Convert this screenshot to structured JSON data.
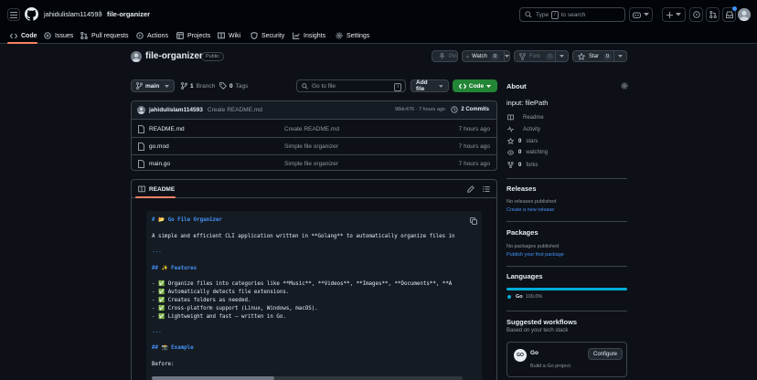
{
  "header": {
    "owner": "jahidulislam114593",
    "separator": "/",
    "repo": "file-organizer",
    "search_prefix": "Type",
    "search_key": "/",
    "search_suffix": "to search"
  },
  "tabs": [
    {
      "label": "Code",
      "icon": "code-icon"
    },
    {
      "label": "Issues",
      "icon": "issue-icon"
    },
    {
      "label": "Pull requests",
      "icon": "pull-request-icon"
    },
    {
      "label": "Actions",
      "icon": "play-icon"
    },
    {
      "label": "Projects",
      "icon": "table-icon"
    },
    {
      "label": "Wiki",
      "icon": "book-icon"
    },
    {
      "label": "Security",
      "icon": "shield-icon"
    },
    {
      "label": "Insights",
      "icon": "graph-icon"
    },
    {
      "label": "Settings",
      "icon": "gear-icon"
    }
  ],
  "repo_header": {
    "title": "file-organizer",
    "visibility": "Public",
    "pin": "Pin",
    "watch": "Watch",
    "watch_count": "0",
    "fork": "Fork",
    "fork_count": "0",
    "star": "Star",
    "star_count": "0"
  },
  "file_nav": {
    "branch": "main",
    "branch_count": "1",
    "branch_label": "Branch",
    "tag_count": "0",
    "tag_label": "Tags",
    "go_to_file": "Go to file",
    "go_to_file_key": "t",
    "add_file": "Add file",
    "code": "Code"
  },
  "latest_commit": {
    "author": "jahidulislam114593",
    "message": "Create README.md",
    "meta": "98dc476 · 7 hours ago",
    "commits": "2 Commits"
  },
  "files": [
    {
      "name": "README.md",
      "message": "Create README.md",
      "time": "7 hours ago"
    },
    {
      "name": "go.mod",
      "message": "Simple file organizer",
      "time": "7 hours ago"
    },
    {
      "name": "main.go",
      "message": "Simple file organizer",
      "time": "7 hours ago"
    }
  ],
  "readme": {
    "tab": "README",
    "lines": [
      {
        "text": "# 📂 Go File Organizer",
        "kind": "h"
      },
      {
        "text": "A simple and efficient CLI application written in **Golang** to automatically organize files in",
        "kind": "p"
      },
      {
        "text": "---",
        "kind": "hr"
      },
      {
        "text": "## ✨ Features",
        "kind": "h"
      },
      {
        "text": "- ✅ Organize files into categories like **Music**, **Videos**, **Images**, **Documents**, **A",
        "kind": "p"
      },
      {
        "text": "- ✅ Automatically detects file extensions.",
        "kind": "p"
      },
      {
        "text": "- ✅ Creates folders as needed.",
        "kind": "p"
      },
      {
        "text": "- ✅ Cross-platform support (Linux, Windows, macOS).",
        "kind": "p"
      },
      {
        "text": "- ✅ Lightweight and fast — written in Go.",
        "kind": "p"
      },
      {
        "text": "---",
        "kind": "hr"
      },
      {
        "text": "## 📸 Example",
        "kind": "h"
      },
      {
        "text": "Before:",
        "kind": "p"
      }
    ]
  },
  "about": {
    "title": "About",
    "description": "input: filePath",
    "items": [
      {
        "icon": "book-icon",
        "bold": "",
        "label": "Readme"
      },
      {
        "icon": "pulse-icon",
        "bold": "",
        "label": "Activity"
      },
      {
        "icon": "star-icon",
        "bold": "0",
        "label": "stars"
      },
      {
        "icon": "eye-icon",
        "bold": "0",
        "label": "watching"
      },
      {
        "icon": "fork-icon",
        "bold": "0",
        "label": "forks"
      }
    ]
  },
  "releases": {
    "title": "Releases",
    "text": "No releases published",
    "link": "Create a new release"
  },
  "packages": {
    "title": "Packages",
    "text": "No packages published",
    "link": "Publish your first package"
  },
  "languages": {
    "title": "Languages",
    "name": "Go",
    "percent": "100.0%",
    "value": 100,
    "color": "#00add8"
  },
  "workflows": {
    "title": "Suggested workflows",
    "subtitle": "Based on your tech stack",
    "card_name": "Go",
    "card_desc": "Build a Go project.",
    "configure": "Configure",
    "logo_text": "GO"
  },
  "colors": {
    "accent_green": "#238636",
    "link_blue": "#4493f8",
    "tab_underline": "#f78166"
  }
}
